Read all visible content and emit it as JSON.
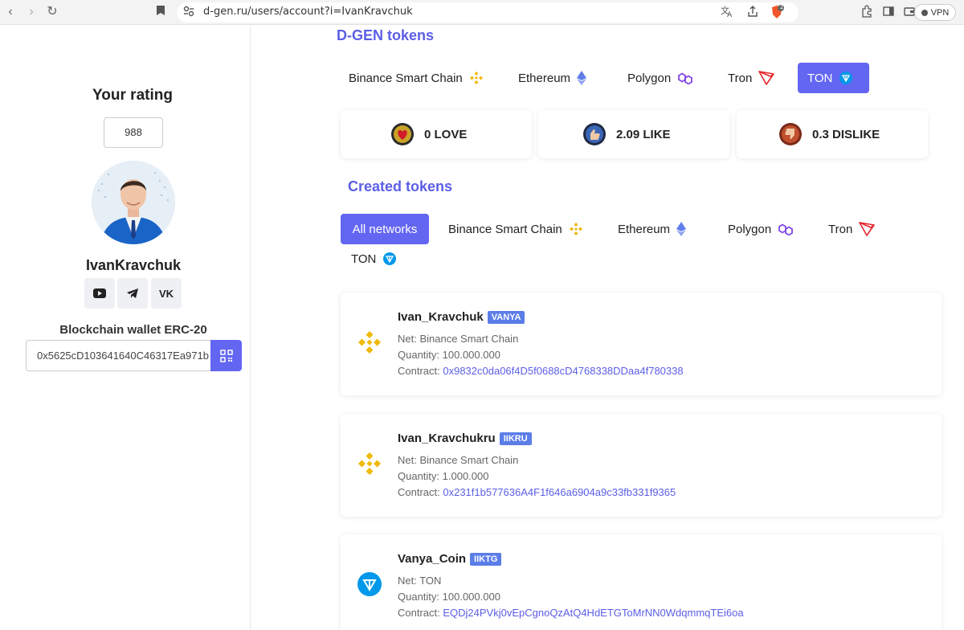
{
  "browser": {
    "url": "d-gen.ru/users/account?i=IvanKravchuk",
    "vpn_label": "VPN",
    "shield_badge": "1"
  },
  "sidebar": {
    "rating_title": "Your rating",
    "rating_value": "988",
    "username": "IvanKravchuk",
    "social": {
      "vk_label": "VK"
    },
    "wallet_title": "Blockchain wallet ERC-20",
    "wallet_address": "0x5625cD103641640C46317Ea971b"
  },
  "dgen": {
    "title": "D-GEN tokens",
    "networks": [
      {
        "label": "Binance Smart Chain",
        "icon": "bnb-icon"
      },
      {
        "label": "Ethereum",
        "icon": "eth-icon"
      },
      {
        "label": "Polygon",
        "icon": "polygon-icon"
      },
      {
        "label": "Tron",
        "icon": "tron-icon"
      },
      {
        "label": "TON",
        "icon": "ton-icon",
        "active": true
      }
    ],
    "ratings": [
      {
        "label": "0 LOVE",
        "icon": "heart-coin-icon"
      },
      {
        "label": "2.09 LIKE",
        "icon": "like-coin-icon"
      },
      {
        "label": "0.3 DISLIKE",
        "icon": "dislike-coin-icon"
      }
    ]
  },
  "created": {
    "title": "Created tokens",
    "filters": [
      {
        "label": "All networks",
        "active": true
      },
      {
        "label": "Binance Smart Chain",
        "icon": "bnb-icon"
      },
      {
        "label": "Ethereum",
        "icon": "eth-icon"
      },
      {
        "label": "Polygon",
        "icon": "polygon-icon"
      },
      {
        "label": "Tron",
        "icon": "tron-icon"
      },
      {
        "label": "TON",
        "icon": "ton-icon"
      }
    ],
    "tokens": [
      {
        "name": "Ivan_Kravchuk",
        "ticker": "VANYA",
        "net": "Net: Binance Smart Chain",
        "quantity": "Quantity: 100.000.000",
        "contract_label": "Contract: ",
        "contract": "0x9832c0da06f4D5f0688cD4768338DDaa4f780338",
        "icon": "bnb-icon"
      },
      {
        "name": "Ivan_Kravchukru",
        "ticker": "IIKRU",
        "net": "Net: Binance Smart Chain",
        "quantity": "Quantity: 1.000.000",
        "contract_label": "Contract: ",
        "contract": "0x231f1b577636A4F1f646a6904a9c33fb331f9365",
        "icon": "bnb-icon"
      },
      {
        "name": "Vanya_Coin",
        "ticker": "IIKTG",
        "net": "Net: TON",
        "quantity": "Quantity: 100.000.000",
        "contract_label": "Contract: ",
        "contract": "EQDj24PVkj0vEpCgnoQzAtQ4HdETGToMrNN0WdqmmqTEi6oa",
        "icon": "ton-icon"
      }
    ]
  },
  "colors": {
    "accent": "#6366f1",
    "title": "#5b5ee6",
    "ticker": "#5b7de8",
    "bnb": "#f0b90b",
    "eth": "#627eea",
    "polygon": "#8247e5",
    "tron": "#e5262d",
    "ton": "#0098ea"
  }
}
